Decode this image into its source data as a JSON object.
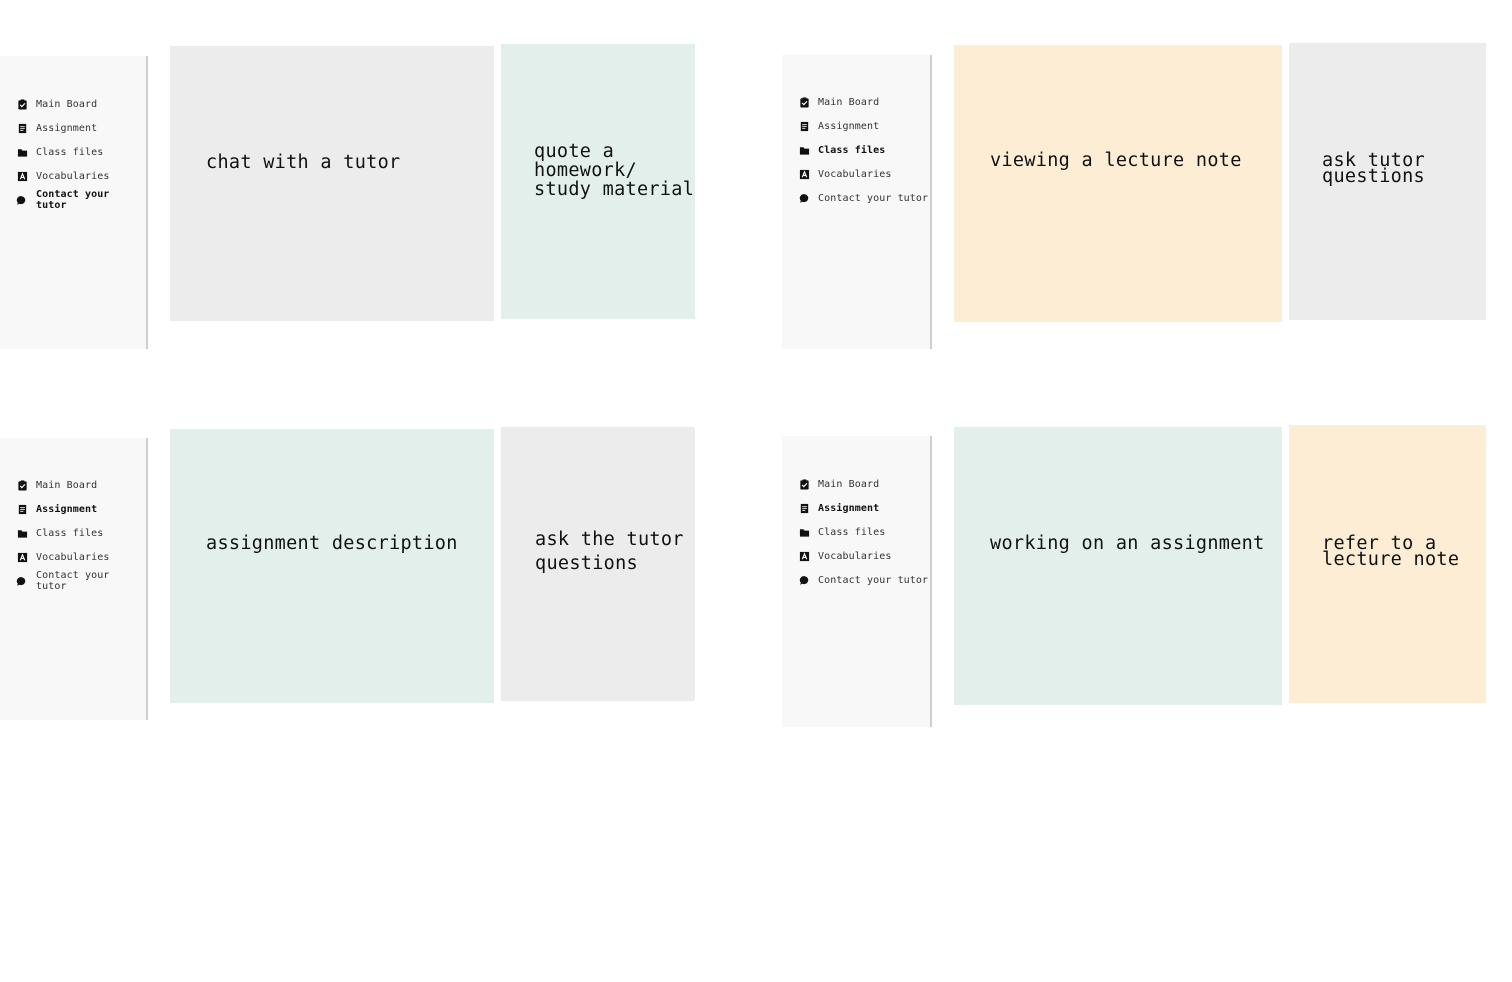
{
  "nav_labels": {
    "main_board": "Main Board",
    "assignment": "Assignment",
    "class_files": "Class files",
    "vocabularies": "Vocabularies",
    "contact_tutor": "Contact your tutor"
  },
  "icons": {
    "main_board": "clipboard-check-icon",
    "assignment": "document-icon",
    "class_files": "folder-icon",
    "vocabularies": "letter-a-icon",
    "contact_tutor": "chat-bubble-icon"
  },
  "colors": {
    "sidebar_bg": "#f8f8f8",
    "panel_gray": "#ececec",
    "panel_green": "#e3efea",
    "panel_peach": "#fdedd4"
  },
  "screens": [
    {
      "active_nav": "Contact your tutor",
      "main_panel": {
        "text": "chat with a tutor",
        "color": "gray"
      },
      "side_panel": {
        "text": "quote a\nhomework/\nstudy material",
        "color": "green"
      }
    },
    {
      "active_nav": "Class files",
      "main_panel": {
        "text": "viewing a lecture note",
        "color": "peach"
      },
      "side_panel": {
        "text": "ask tutor\nquestions",
        "color": "gray"
      }
    },
    {
      "active_nav": "Assignment",
      "main_panel": {
        "text": "assignment description",
        "color": "green"
      },
      "side_panel": {
        "text": "ask the tutor\nquestions",
        "color": "gray"
      }
    },
    {
      "active_nav": "Assignment",
      "main_panel": {
        "text": "working on an assignment",
        "color": "green"
      },
      "side_panel": {
        "text": "refer to a\nlecture note",
        "color": "peach"
      }
    }
  ]
}
